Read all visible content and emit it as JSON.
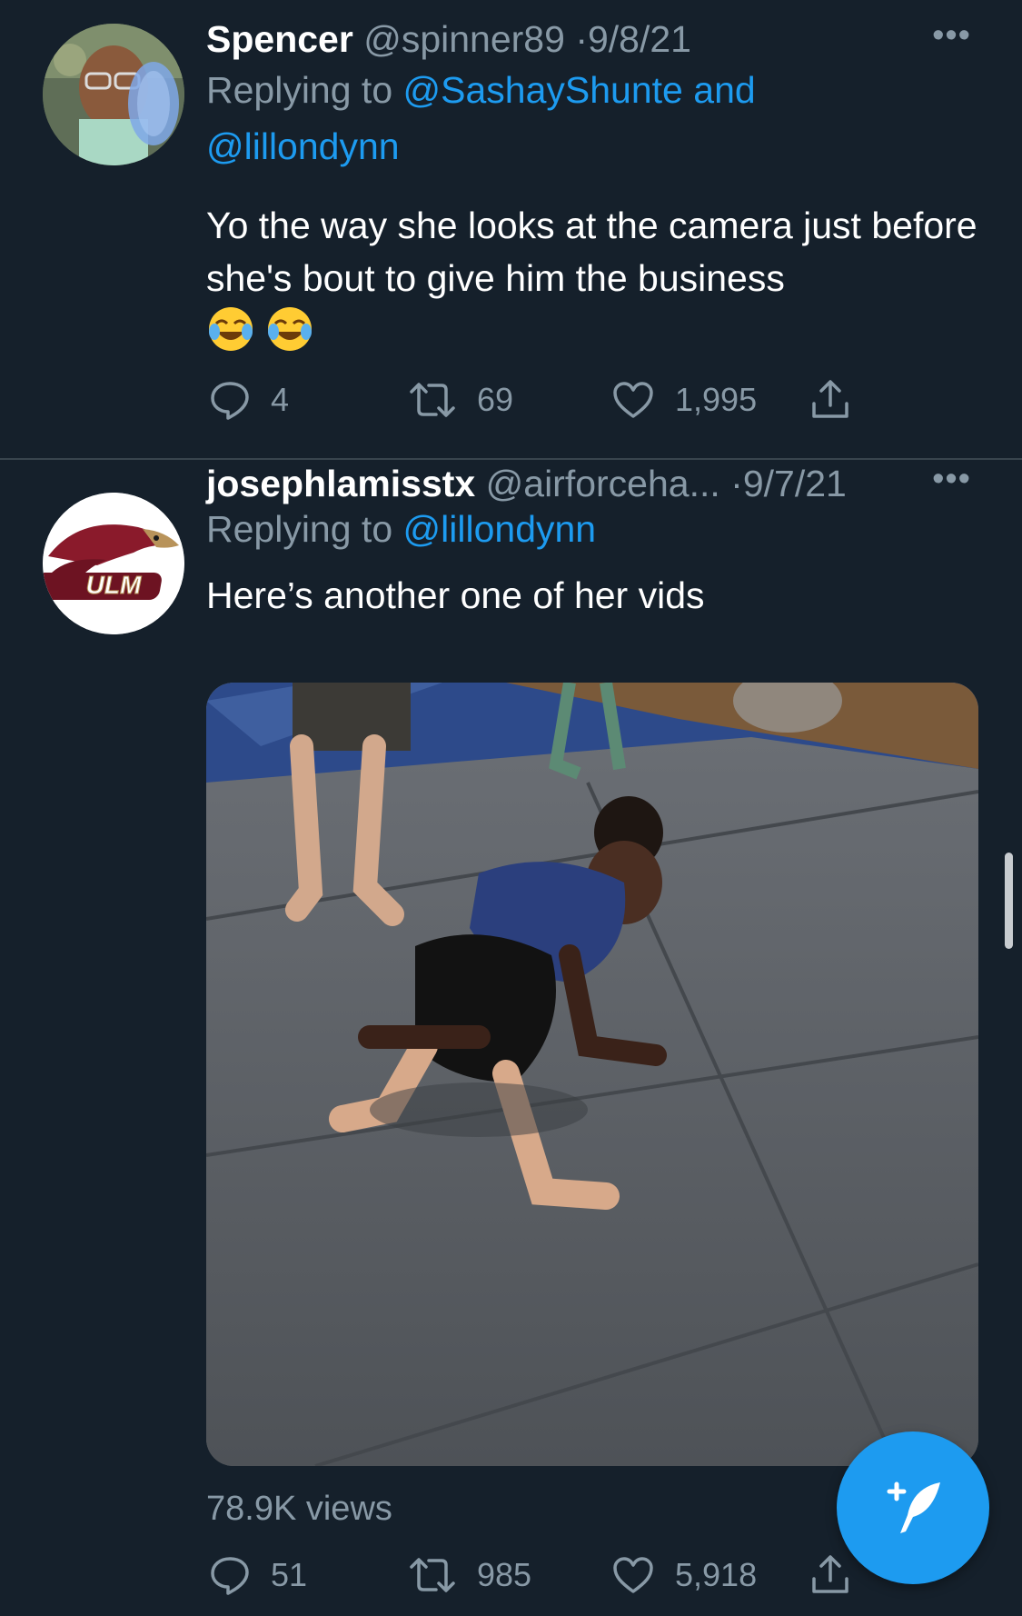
{
  "tweets": [
    {
      "name": "Spencer",
      "handle": "@spinner89",
      "separator": "·",
      "date": "9/8/21",
      "more": "•••",
      "replying_prefix": "Replying to",
      "replying_mention_1": "@SashayShunte",
      "replying_joiner": "and",
      "replying_mention_2": "@lillondynn",
      "text": "Yo the way she looks at the camera just before she's bout to give him the business",
      "emojis": [
        "face-with-tears-of-joy",
        "face-with-tears-of-joy"
      ],
      "actions": {
        "replies": "4",
        "retweets": "69",
        "likes": "1,995"
      }
    },
    {
      "name": "josephlamisstx",
      "handle": "@airforceha...",
      "separator": "·",
      "date": "9/7/21",
      "more": "•••",
      "replying_prefix": "Replying to",
      "replying_mention_1": "@lillondynn",
      "text": "Here’s another  one of her vids",
      "avatar_logo_text": "ULM",
      "views": "78.9K views",
      "actions": {
        "replies": "51",
        "retweets": "985",
        "likes": "5,918"
      }
    }
  ],
  "colors": {
    "background": "#15202b",
    "secondary_text": "#8899a6",
    "accent": "#1d9bf0",
    "divider": "#38444d"
  },
  "fab": {
    "icon": "compose-tweet-icon"
  }
}
